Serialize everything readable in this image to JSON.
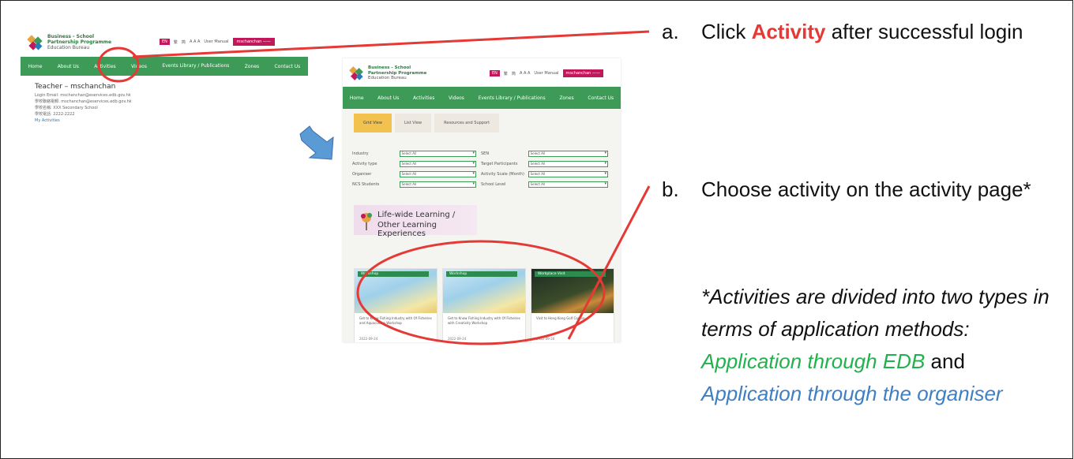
{
  "colors": {
    "nav_green": "#3d9a57",
    "highlight_red": "#e53935",
    "green_text": "#22b14c",
    "blue_text": "#3f7fc4",
    "brand_pink": "#c2185b",
    "tab_yellow": "#f2c14e"
  },
  "site": {
    "logo_line1": "Business - School",
    "logo_line2": "Partnership Programme",
    "logo_line3": "Education Bureau",
    "lang": "EN",
    "lang_tc": "繁",
    "lang_sc": "简",
    "font_sizes": "A A A",
    "user_manual": "User Manual",
    "user_button": "mschanchan ——",
    "nav": [
      "Home",
      "About Us",
      "Activities",
      "Videos",
      "Events Library / Publications",
      "Zones",
      "Contact Us"
    ]
  },
  "profile": {
    "title": "Teacher – mschanchan",
    "email": "Login Email: mschanchan@eservices.edb.gov.hk",
    "alt_email": "學校聯絡電郵: mschanchan@eservices.edb.gov.hk",
    "school": "學校名稱: XXX Secondary School",
    "phone": "學校電話: 2222-2222",
    "my_activities": "My Activities"
  },
  "activity_page": {
    "tabs": [
      "Grid View",
      "List View",
      "Resources and Support"
    ],
    "filters": [
      {
        "left_label": "Industry",
        "left_value": "Select All",
        "right_label": "SEN",
        "right_value": "Select All"
      },
      {
        "left_label": "Activity type",
        "left_value": "Select All",
        "right_label": "Target Participants",
        "right_value": "Select All"
      },
      {
        "left_label": "Organiser",
        "left_value": "Select All",
        "right_label": "Activity Scale (Month)",
        "right_value": "Select All"
      },
      {
        "left_label": "NCS Students",
        "left_value": "Select All",
        "right_label": "School Level",
        "right_value": "Select All"
      }
    ],
    "banner_line1": "Life-wide Learning /",
    "banner_line2": "Other Learning Experiences",
    "cards": [
      {
        "badge": "Workshop",
        "desc": "Get to Know Fishing Industry with Of Fisheries and Aquaculture Workshop",
        "date": "2022-09-24"
      },
      {
        "badge": "Workshop",
        "desc": "Get to Know Fishing Industry with Of Fisheries with Creativity Workshop",
        "date": "2022-09-24"
      },
      {
        "badge": "Workplace Visit",
        "desc": "Visit to Hong Kong Golf Course",
        "date": "2022-09-30"
      }
    ]
  },
  "instructions": {
    "a_marker": "a.",
    "a_pre": "Click ",
    "a_highlight": "Activity",
    "a_post": " after successful login",
    "b_marker": "b.",
    "b_text": "Choose activity on the activity page*",
    "note": "*Activities are divided into two types in terms of application methods:",
    "method1": "Application through EDB",
    "joiner": " and ",
    "method2": "Application through the organiser"
  }
}
